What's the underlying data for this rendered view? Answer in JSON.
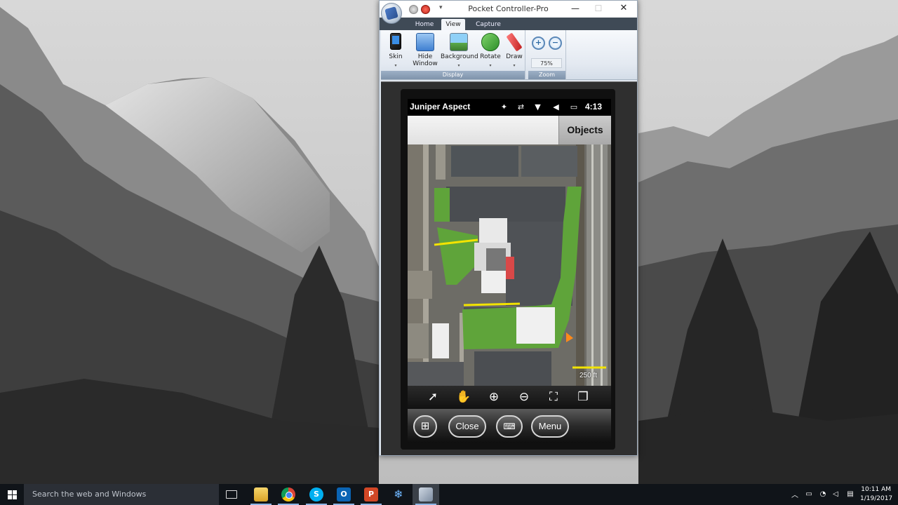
{
  "window": {
    "title": "Pocket Controller-Pro",
    "min_symbol": "—",
    "max_symbol": "☐",
    "close_symbol": "✕"
  },
  "ribbon": {
    "tabs": [
      {
        "label": "Home"
      },
      {
        "label": "View"
      },
      {
        "label": "Capture"
      }
    ],
    "display_group": {
      "label": "Display",
      "buttons": [
        {
          "label": "Skin",
          "icon": "phone-skin-icon"
        },
        {
          "label": "Hide Window",
          "icon": "hide-window-icon"
        },
        {
          "label": "Background",
          "icon": "background-image-icon"
        },
        {
          "label": "Rotate",
          "icon": "rotate-icon"
        },
        {
          "label": "Draw",
          "icon": "pencil-icon"
        }
      ]
    },
    "zoom_group": {
      "label": "Zoom",
      "zoom_in": "+",
      "zoom_out": "−",
      "level": "75%"
    },
    "dropdown_mark": "▾"
  },
  "phone": {
    "app_name": "Juniper Aspect",
    "clock": "4:13",
    "status_icons": [
      "satellite-icon",
      "sync-icon",
      "signal-icon",
      "volume-muted-icon",
      "battery-icon"
    ],
    "objects_button": "Objects",
    "map": {
      "scale_label": "250 ft"
    },
    "map_tools": [
      "select-arrow-icon",
      "pan-hand-icon",
      "zoom-in-icon",
      "zoom-out-icon",
      "zoom-extent-icon",
      "layers-icon"
    ],
    "softkeys": {
      "start": "⊞",
      "close": "Close",
      "keyboard": "⌨",
      "menu": "Menu"
    }
  },
  "taskbar": {
    "search_placeholder": "Search the web and Windows",
    "apps": [
      "task-view-icon",
      "file-explorer-icon",
      "chrome-icon",
      "skype-icon",
      "outlook-icon",
      "powerpoint-icon",
      "snowflake-icon",
      "pocket-controller-icon"
    ],
    "time": "10:11 AM",
    "date": "1/19/2017"
  },
  "colors": {
    "ribbon_tab_bar": "#3f4a56",
    "taskbar": "#101419",
    "map_green": "#5fa43a",
    "map_yellow": "#f2e300"
  }
}
